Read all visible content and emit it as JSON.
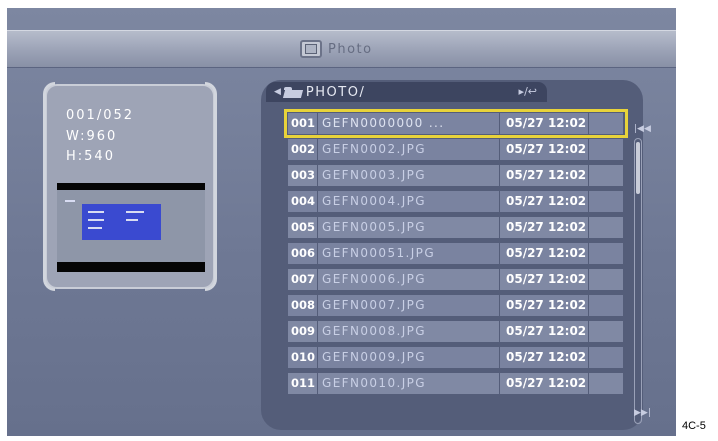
{
  "header": {
    "title": "Photo",
    "icon": "photo-icon"
  },
  "info": {
    "index": "001/052",
    "width": "W:960",
    "height": "H:540"
  },
  "path": {
    "text": "PHOTO/",
    "left_icon": "folder-icon",
    "right_icon": "return-icon"
  },
  "files": [
    {
      "num": "001",
      "name": "GEFN0000000 ...",
      "date": "05/27 12:02",
      "selected": true
    },
    {
      "num": "002",
      "name": "GEFN0002.JPG",
      "date": "05/27 12:02"
    },
    {
      "num": "003",
      "name": "GEFN0003.JPG",
      "date": "05/27 12:02"
    },
    {
      "num": "004",
      "name": "GEFN0004.JPG",
      "date": "05/27 12:02"
    },
    {
      "num": "005",
      "name": "GEFN0005.JPG",
      "date": "05/27 12:02"
    },
    {
      "num": "006",
      "name": "GEFN00051.JPG",
      "date": "05/27 12:02"
    },
    {
      "num": "007",
      "name": "GEFN0006.JPG",
      "date": "05/27 12:02"
    },
    {
      "num": "008",
      "name": "GEFN0007.JPG",
      "date": "05/27 12:02"
    },
    {
      "num": "009",
      "name": "GEFN0008.JPG",
      "date": "05/27 12:02"
    },
    {
      "num": "010",
      "name": "GEFN0009.JPG",
      "date": "05/27 12:02"
    },
    {
      "num": "011",
      "name": "GEFN0010.JPG",
      "date": "05/27 12:02"
    }
  ],
  "scroll": {
    "up_icon": "skip-up-icon",
    "down_icon": "skip-down-icon"
  },
  "caption": "4C-5",
  "colors": {
    "highlight": "#e8d33a",
    "background": "#6f7995",
    "panel": "#545d79"
  }
}
